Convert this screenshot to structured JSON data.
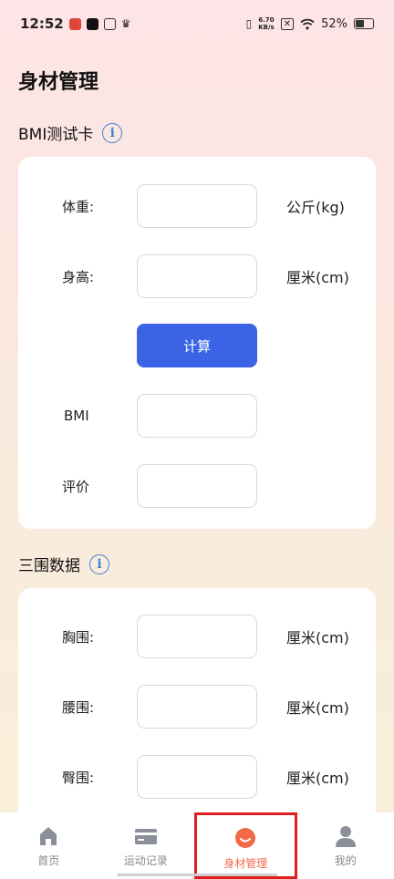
{
  "status_bar": {
    "time": "12:52",
    "net_speed_value": "6.70",
    "net_speed_unit": "KB/s",
    "battery": "52%",
    "battery_level": 0.52
  },
  "page_title": "身材管理",
  "bmi_section": {
    "title": "BMI测试卡",
    "info_icon": "i",
    "rows": [
      {
        "label": "体重:",
        "value": "",
        "unit": "公斤(kg)"
      },
      {
        "label": "身高:",
        "value": "",
        "unit": "厘米(cm)"
      }
    ],
    "calc_label": "计算",
    "results": [
      {
        "label": "BMI",
        "value": ""
      },
      {
        "label": "评价",
        "value": ""
      }
    ]
  },
  "measure_section": {
    "title": "三围数据",
    "info_icon": "i",
    "rows": [
      {
        "label": "胸围:",
        "value": "",
        "unit": "厘米(cm)"
      },
      {
        "label": "腰围:",
        "value": "",
        "unit": "厘米(cm)"
      },
      {
        "label": "臀围:",
        "value": "",
        "unit": "厘米(cm)"
      }
    ]
  },
  "bottom_nav": {
    "items": [
      {
        "label": "首页",
        "icon": "home-icon"
      },
      {
        "label": "运动记录",
        "icon": "card-icon"
      },
      {
        "label": "身材管理",
        "icon": "smile-bubble-icon",
        "active": true
      },
      {
        "label": "我的",
        "icon": "user-icon"
      }
    ]
  },
  "colors": {
    "accent": "#3a63e6",
    "active_tab": "#f06a4a",
    "info_icon": "#3b82d6",
    "highlight_box": "#e01e1e"
  }
}
